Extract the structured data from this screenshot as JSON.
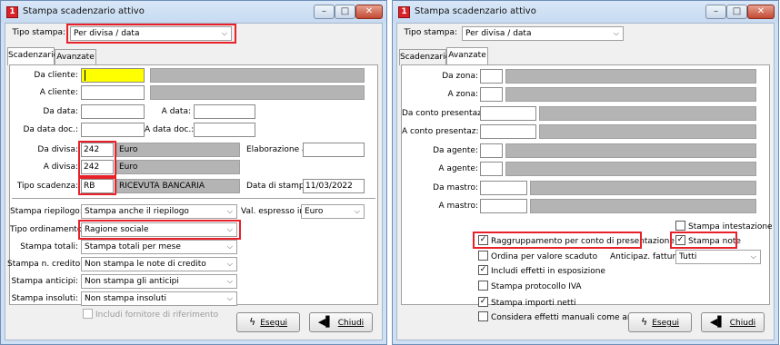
{
  "colors": {
    "highlight": "#e8202a",
    "yellow_field": "#ffff00",
    "gray_field": "#b4b4b4"
  },
  "left": {
    "title": "Stampa scadenzario attivo",
    "tipo_stampa_label": "Tipo stampa:",
    "tipo_stampa_value": "Per divisa / data",
    "tabs": [
      "Scadenzario",
      "Avanzate"
    ],
    "da_cliente": "Da cliente:",
    "a_cliente": "A cliente:",
    "da_data": "Da data:",
    "a_data": "A data:",
    "da_data_doc": "Da data doc.:",
    "a_data_doc": "A data doc.:",
    "da_divisa": "Da divisa:",
    "da_divisa_code": "242",
    "da_divisa_desc": "Euro",
    "elaborazione_al": "Elaborazione al:",
    "a_divisa": "A divisa:",
    "a_divisa_code": "242",
    "a_divisa_desc": "Euro",
    "tipo_scadenza": "Tipo scadenza:",
    "tipo_scadenza_code": "RB",
    "tipo_scadenza_desc": "RICEVUTA BANCARIA",
    "data_di_stampa": "Data di stampa:",
    "data_di_stampa_value": "11/03/2022",
    "stampa_riepilogo": "Stampa riepilogo:",
    "stampa_riepilogo_value": "Stampa anche il riepilogo",
    "val_espresso_in": "Val. espresso in:",
    "val_espresso_in_value": "Euro",
    "tipo_ordinamento": "Tipo ordinamento:",
    "tipo_ordinamento_value": "Ragione sociale",
    "stampa_totali": "Stampa totali:",
    "stampa_totali_value": "Stampa totali per mese",
    "stampa_n_credito": "Stampa n. credito:",
    "stampa_n_credito_value": "Non stampa le note di credito",
    "stampa_anticipi": "Stampa anticipi:",
    "stampa_anticipi_value": "Non stampa gli anticipi",
    "stampa_insoluti": "Stampa insoluti:",
    "stampa_insoluti_value": "Non stampa insoluti",
    "includi_fornitore": "Includi fornitore di riferimento",
    "esegui": "Esegui",
    "chiudi": "Chiudi"
  },
  "right": {
    "title": "Stampa scadenzario attivo",
    "tipo_stampa_label": "Tipo stampa:",
    "tipo_stampa_value": "Per divisa / data",
    "tabs": [
      "Scadenzario",
      "Avanzate"
    ],
    "da_zona": "Da zona:",
    "a_zona": "A zona:",
    "da_conto": "Da conto presentaz:",
    "a_conto": "A conto presentaz:",
    "da_agente": "Da agente:",
    "a_agente": "A agente:",
    "da_mastro": "Da mastro:",
    "a_mastro": "A mastro:",
    "stampa_intestazione": "Stampa intestazione",
    "raggruppamento": "Raggruppamento per conto di presentazione",
    "stampa_note": "Stampa note",
    "ordina_valore": "Ordina per valore scaduto",
    "anticipaz_fattura": "Anticipaz. fattura:",
    "anticipaz_fattura_value": "Tutti",
    "includi_effetti": "Includi effetti in esposizione",
    "stampa_protocollo": "Stampa protocollo IVA",
    "stampa_importi": "Stampa importi netti",
    "considera_effetti": "Considera effetti manuali come anticipi",
    "esegui": "Esegui",
    "chiudi": "Chiudi"
  },
  "icons": {
    "app": "app-logo-icon",
    "esegui": "lightning-icon",
    "chiudi": "exit-door-icon",
    "dropdown": "chevron-down-icon"
  }
}
